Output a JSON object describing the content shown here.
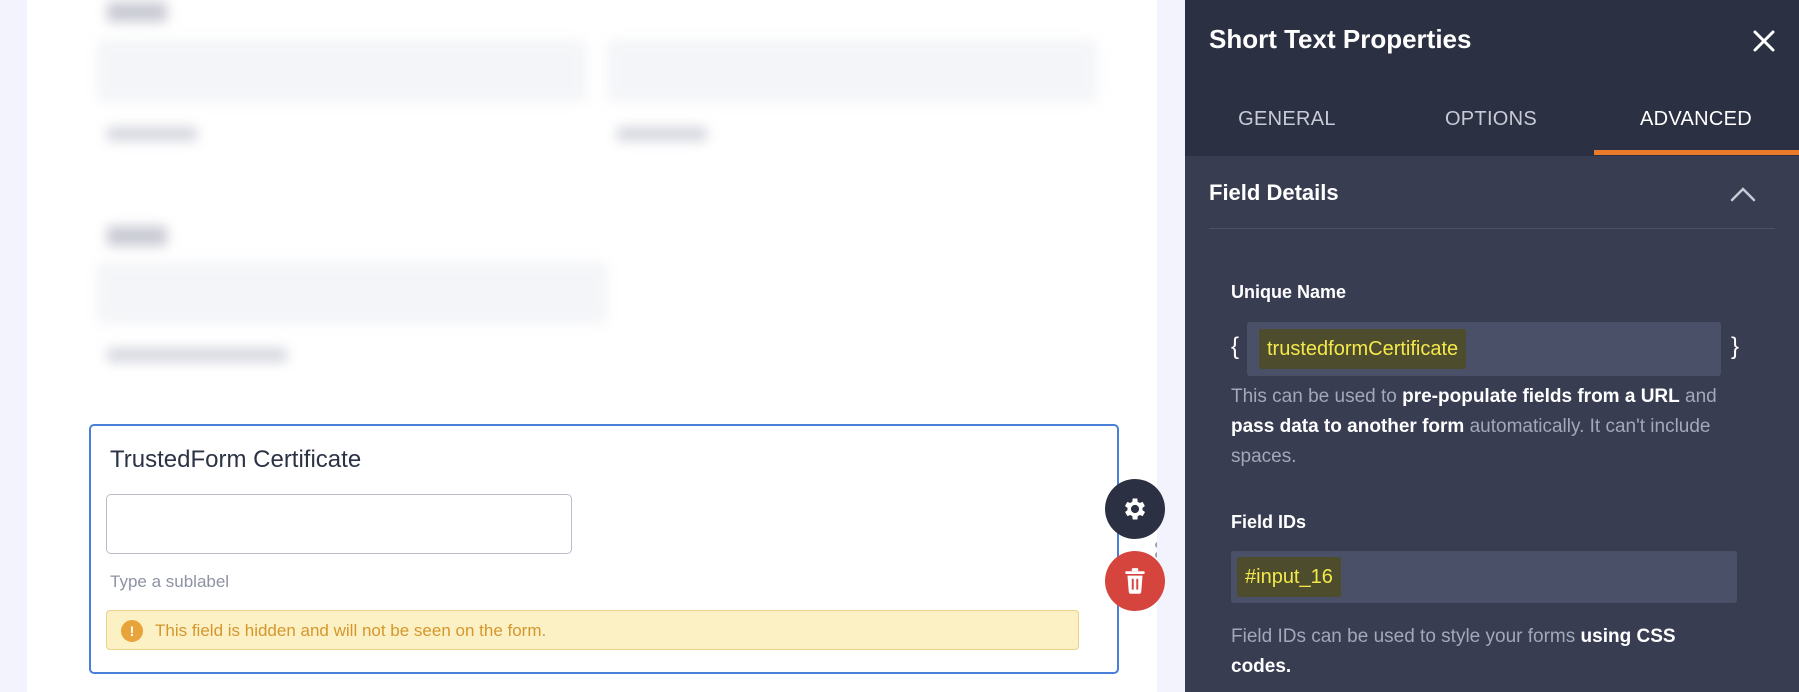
{
  "form": {
    "field_title": "TrustedForm Certificate",
    "sublabel_placeholder": "Type a sublabel",
    "hidden_notice": "This field is hidden and will not be seen on the form.",
    "input_value": ""
  },
  "panel": {
    "title": "Short Text Properties",
    "tabs": [
      {
        "label": "GENERAL",
        "active": false
      },
      {
        "label": "OPTIONS",
        "active": false
      },
      {
        "label": "ADVANCED",
        "active": true
      }
    ],
    "section": {
      "title": "Field Details",
      "unique_name": {
        "label": "Unique Name",
        "brace_open": "{",
        "brace_close": "}",
        "value": "trustedformCertificate",
        "help": {
          "p1": "This can be used to ",
          "b1": "pre-populate fields from a URL",
          "p2": " and ",
          "b2": "pass data to another form",
          "p3": " automatically. It can't include spaces."
        }
      },
      "field_ids": {
        "label": "Field IDs",
        "value": "#input_16",
        "help": {
          "p1": "Field IDs can be used to style your forms ",
          "b1": "using CSS codes."
        }
      }
    }
  },
  "colors": {
    "accent_tab": "#ec7a2b",
    "panel_bg": "#383d52",
    "header_bg": "#2b3043",
    "highlight_text": "#f4e84b",
    "field_border": "#4a7fd9",
    "trash_bg": "#d6453d"
  },
  "icons": {
    "close": "close-icon",
    "chevron": "chevron-up-icon",
    "gear": "gear-icon",
    "trash": "trash-icon",
    "drag": "drag-handle-icon",
    "warning": "exclamation-circle-icon"
  }
}
